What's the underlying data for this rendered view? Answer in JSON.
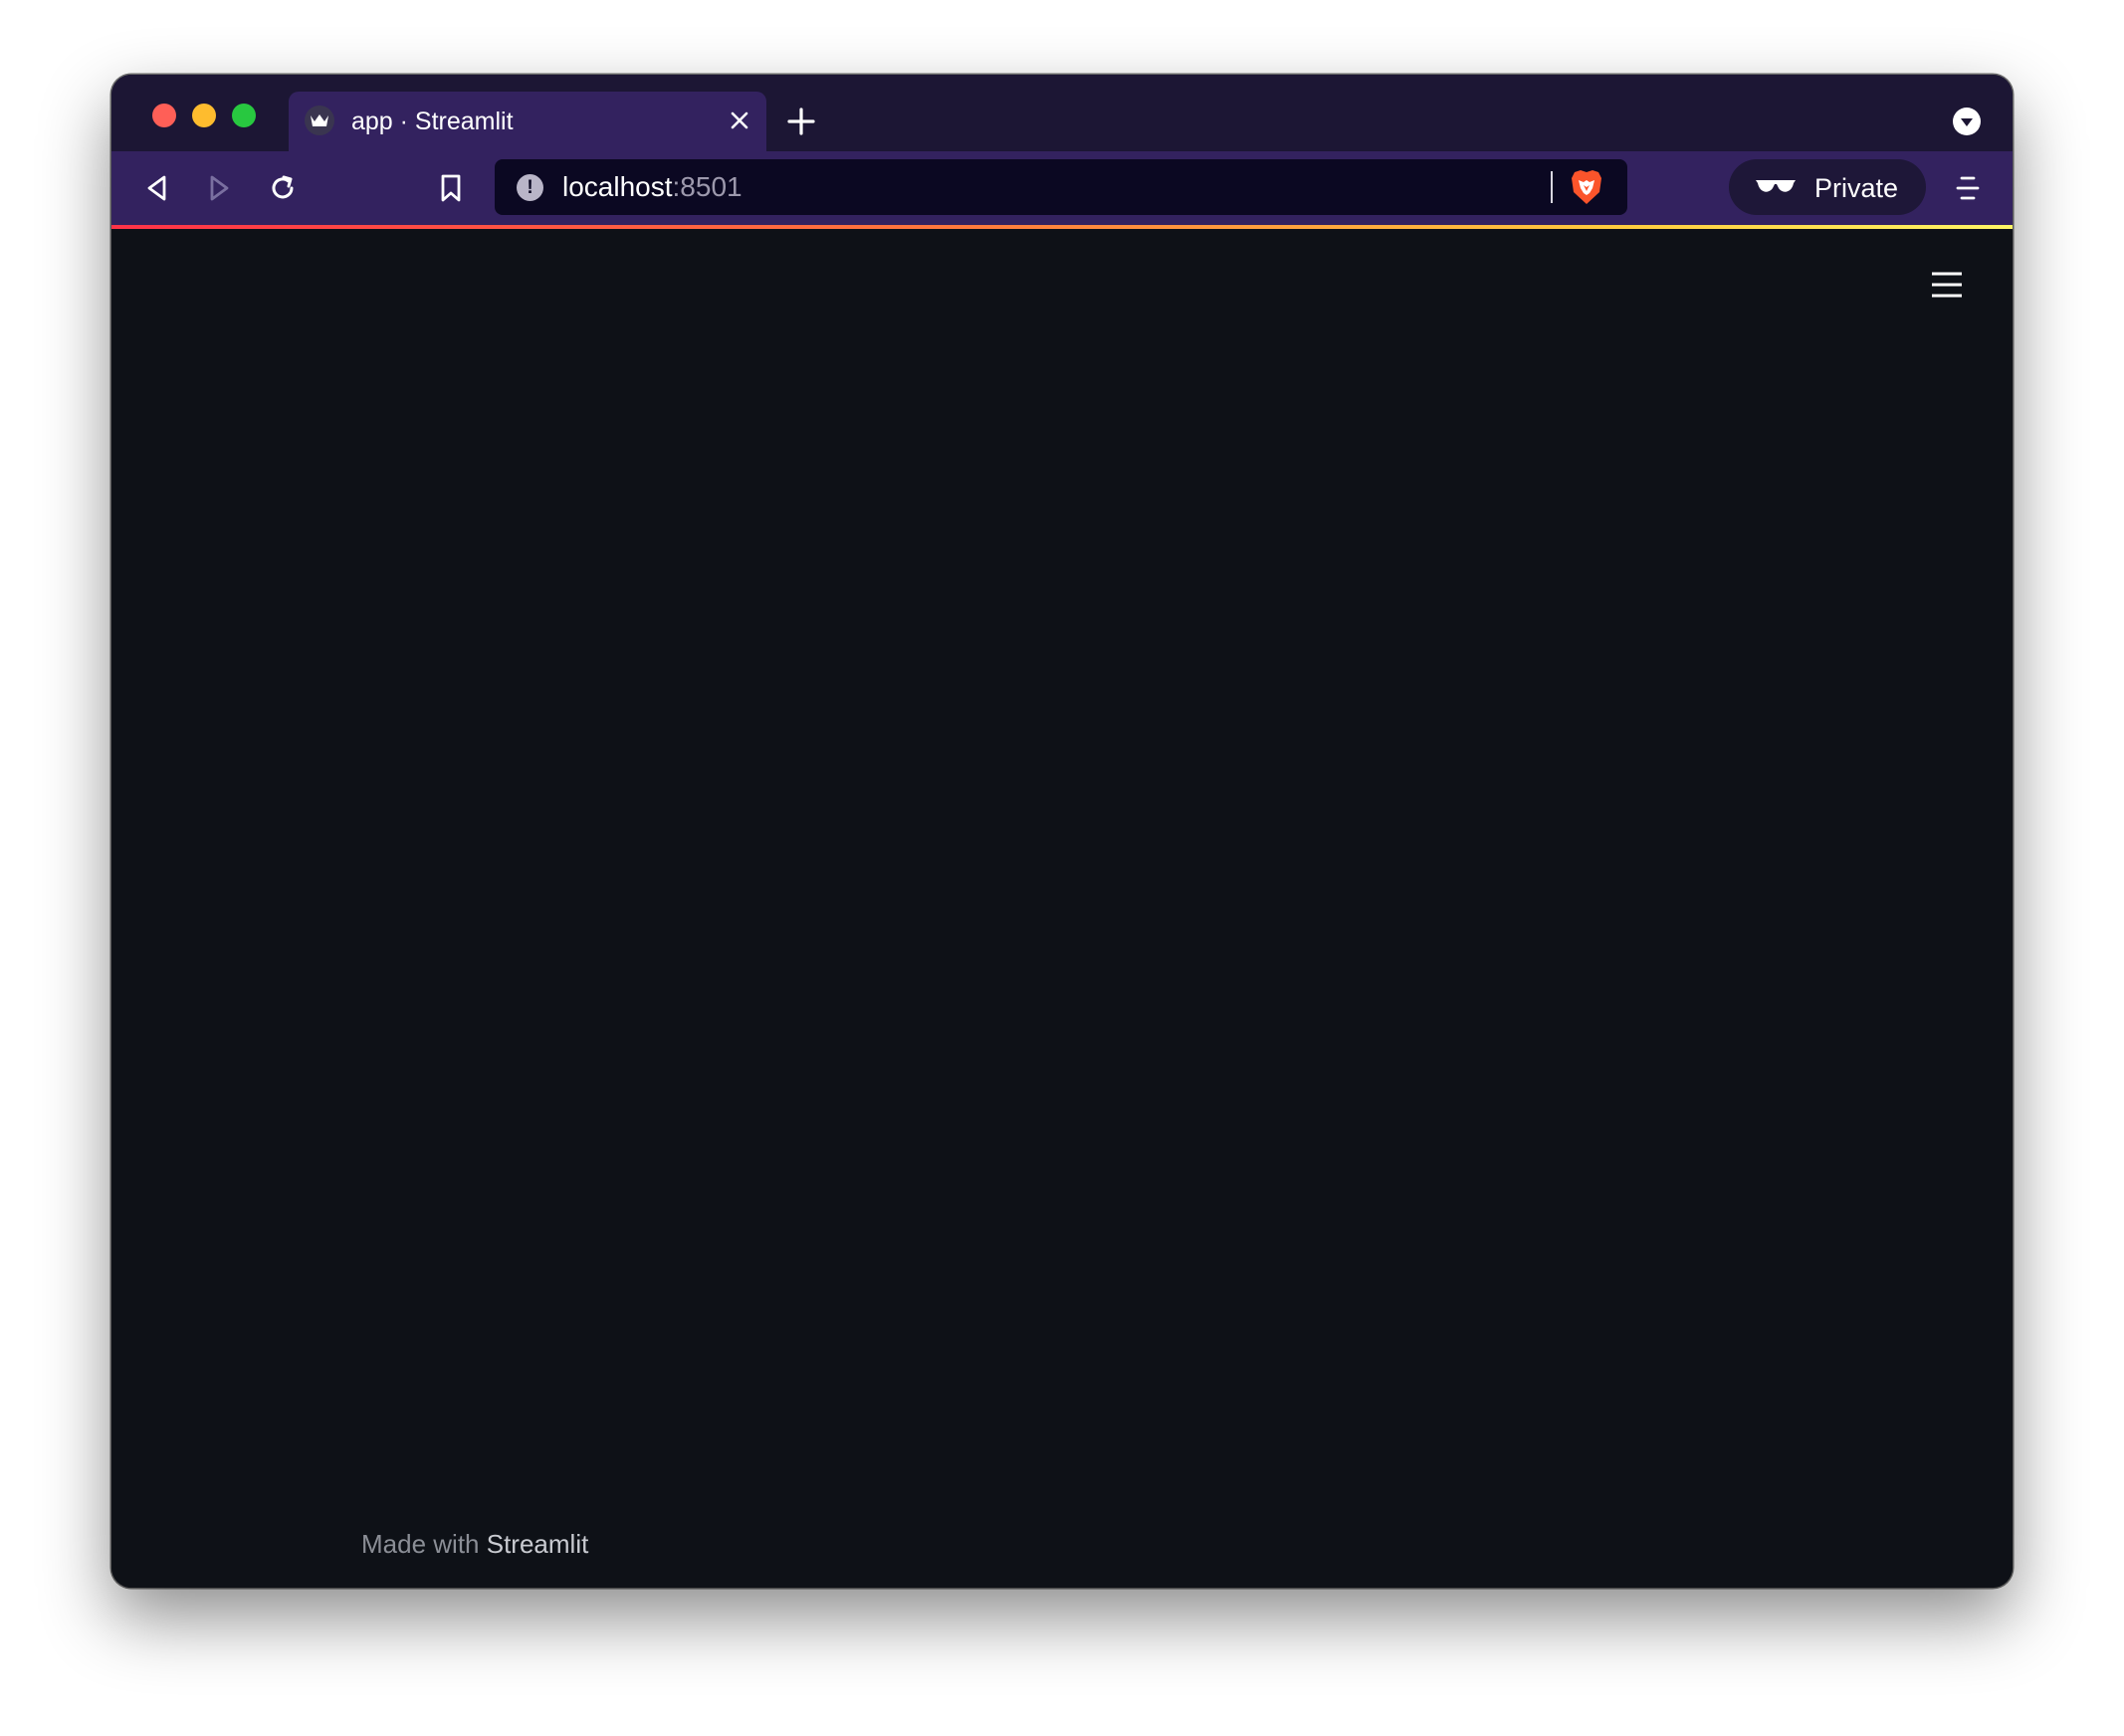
{
  "browser": {
    "tab": {
      "title": "app · Streamlit",
      "favicon": "streamlit-crown-icon"
    },
    "address_bar": {
      "host": "localhost",
      "port": ":8501"
    },
    "private_label": "Private",
    "icons": {
      "back": "back-arrow-icon",
      "forward": "forward-arrow-icon",
      "reload": "reload-icon",
      "bookmark": "bookmark-icon",
      "site_info": "info-icon",
      "shield": "brave-lion-icon",
      "private": "private-glasses-icon",
      "menu": "hamburger-menu-icon"
    },
    "colors": {
      "tabstrip": "#1c1634",
      "toolbar": "#33225f",
      "urlbar": "#0b0822"
    }
  },
  "app": {
    "background": "#0e1117",
    "footer": {
      "prefix": "Made with ",
      "link": "Streamlit"
    }
  }
}
